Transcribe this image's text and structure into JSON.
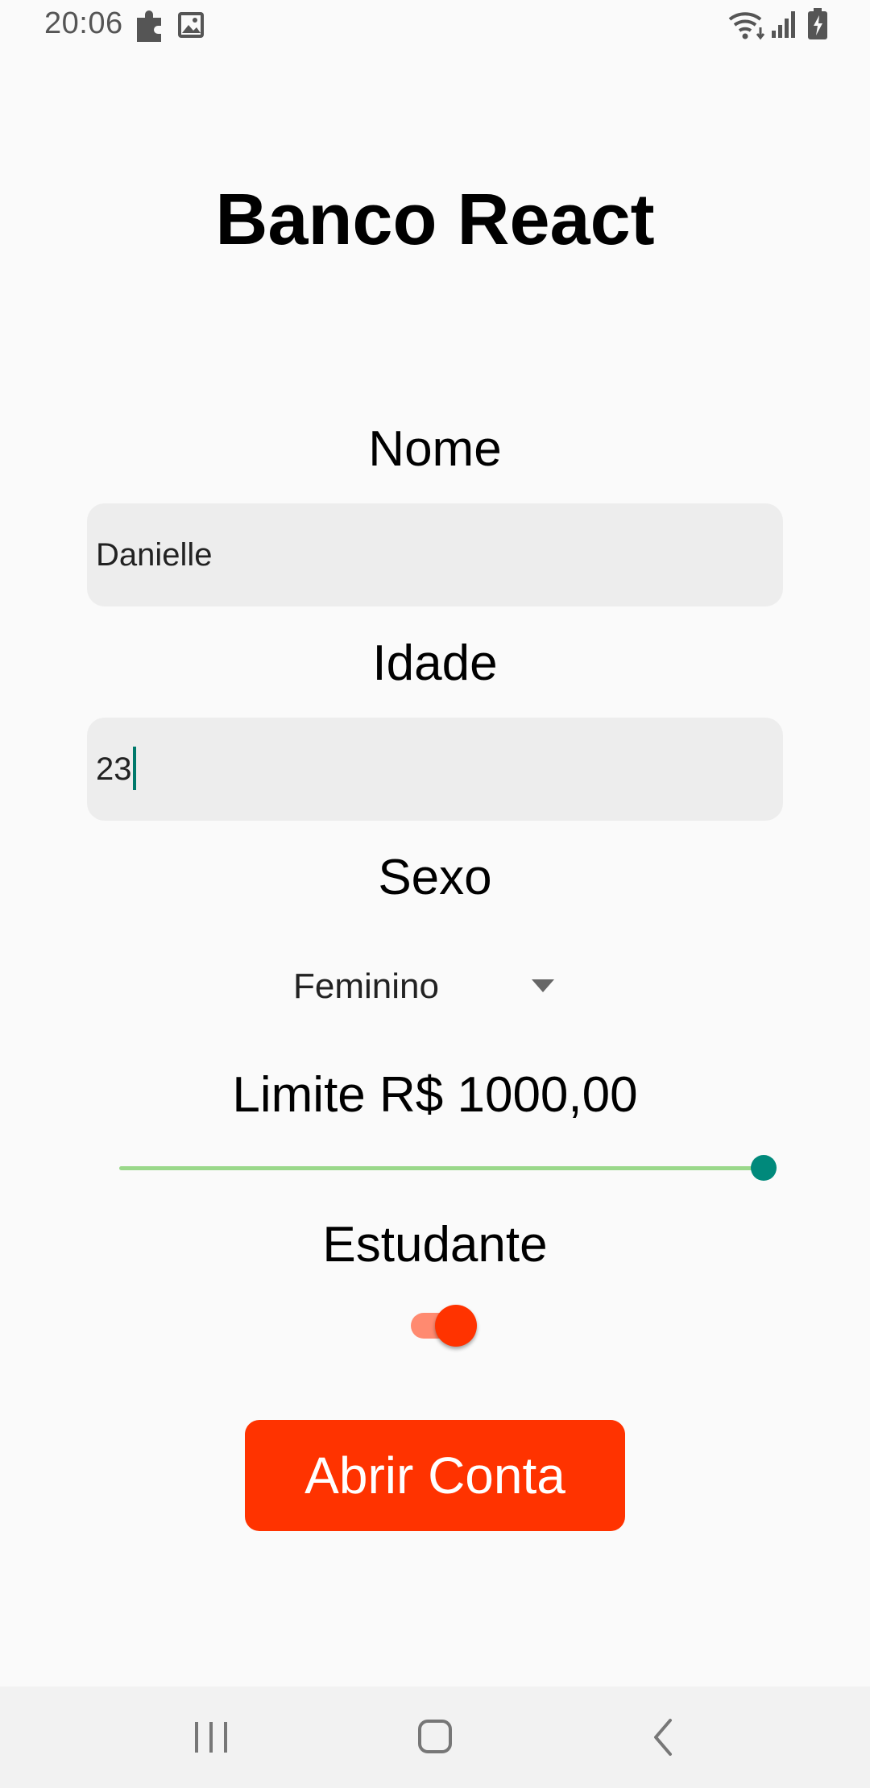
{
  "status_bar": {
    "time": "20:06",
    "left_icons": [
      "puzzle-icon",
      "image-icon"
    ],
    "right_icons": [
      "wifi-icon",
      "signal-icon",
      "battery-charging-icon"
    ]
  },
  "title": "Banco React",
  "form": {
    "nome": {
      "label": "Nome",
      "value": "Danielle"
    },
    "idade": {
      "label": "Idade",
      "value": "23"
    },
    "sexo": {
      "label": "Sexo",
      "selected": "Feminino"
    },
    "limite": {
      "label": "Limite R$ 1000,00",
      "slider_fraction": 1.0
    },
    "estudante": {
      "label": "Estudante",
      "checked": true
    },
    "submit_label": "Abrir Conta"
  },
  "nav_bar": {
    "icons": [
      "recent-apps-icon",
      "home-icon",
      "back-icon"
    ]
  },
  "colors": {
    "accent": "#ff3300",
    "slider_track": "#9ad88a",
    "slider_thumb": "#00897b",
    "toggle_track": "#ff8a70",
    "input_bg": "#ededed"
  }
}
